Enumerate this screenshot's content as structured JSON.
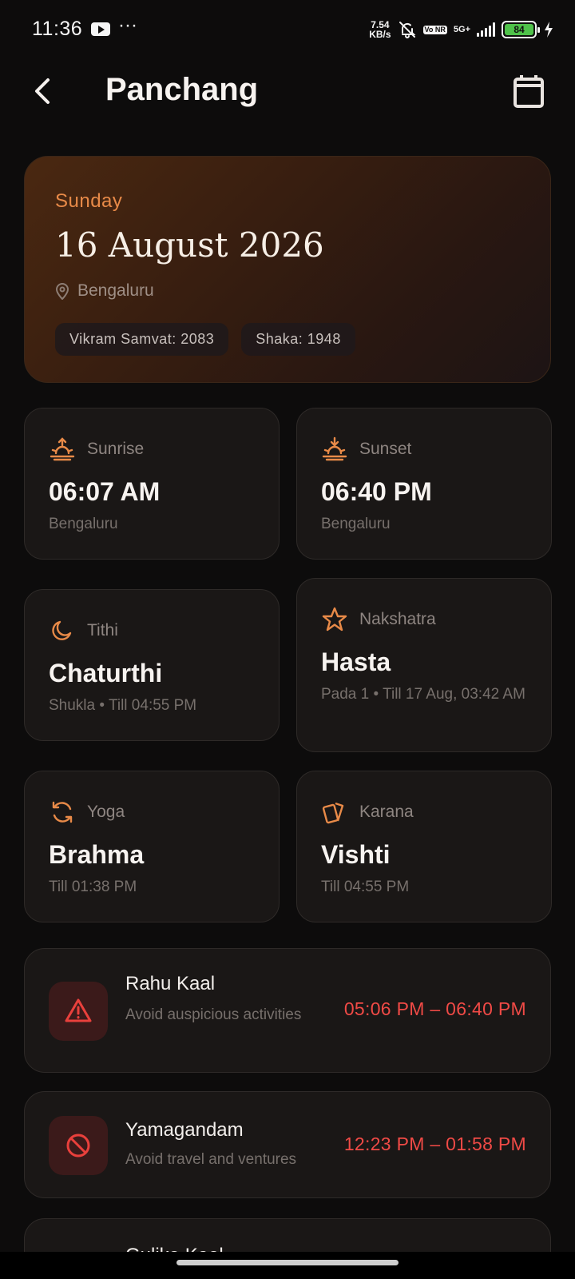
{
  "status_bar": {
    "time": "11:36",
    "dots": "···",
    "speed_value": "7.54",
    "speed_unit": "KB/s",
    "volte": "Vo NR",
    "network": "5G+",
    "battery": "84"
  },
  "header": {
    "title": "Panchang",
    "back_icon": "chevron-left-icon",
    "calendar_icon": "calendar-icon"
  },
  "hero": {
    "day": "Sunday",
    "date": "16 August 2026",
    "location": "Bengaluru",
    "location_icon": "map-pin-icon",
    "chips": [
      "Vikram Samvat: 2083",
      "Shaka: 1948"
    ]
  },
  "cards": {
    "sunrise": {
      "label": "Sunrise",
      "value": "06:07 AM",
      "sub": "Bengaluru",
      "icon": "sunrise-icon"
    },
    "sunset": {
      "label": "Sunset",
      "value": "06:40 PM",
      "sub": "Bengaluru",
      "icon": "sunset-icon"
    },
    "tithi": {
      "label": "Tithi",
      "value": "Chaturthi",
      "sub": "Shukla • Till 04:55 PM",
      "icon": "moon-icon"
    },
    "nakshatra": {
      "label": "Nakshatra",
      "value": "Hasta",
      "sub": "Pada 1 • Till 17 Aug, 03:42 AM",
      "icon": "star-icon"
    },
    "yoga": {
      "label": "Yoga",
      "value": "Brahma",
      "sub": "Till 01:38 PM",
      "icon": "refresh-icon"
    },
    "karana": {
      "label": "Karana",
      "value": "Vishti",
      "sub": "Till 04:55 PM",
      "icon": "cards-icon"
    }
  },
  "kaal": {
    "rahu": {
      "title": "Rahu Kaal",
      "desc": "Avoid auspicious activities",
      "time": "05:06 PM – 06:40 PM",
      "icon": "warning-icon"
    },
    "yamagandam": {
      "title": "Yamagandam",
      "desc": "Avoid travel and ventures",
      "time": "12:23 PM – 01:58 PM",
      "icon": "ban-icon"
    },
    "gulika": {
      "title": "Gulika Kaal"
    }
  },
  "colors": {
    "accent": "#e88a48",
    "danger": "#f04a46",
    "background": "#0d0c0c",
    "card": "#1a1716"
  }
}
